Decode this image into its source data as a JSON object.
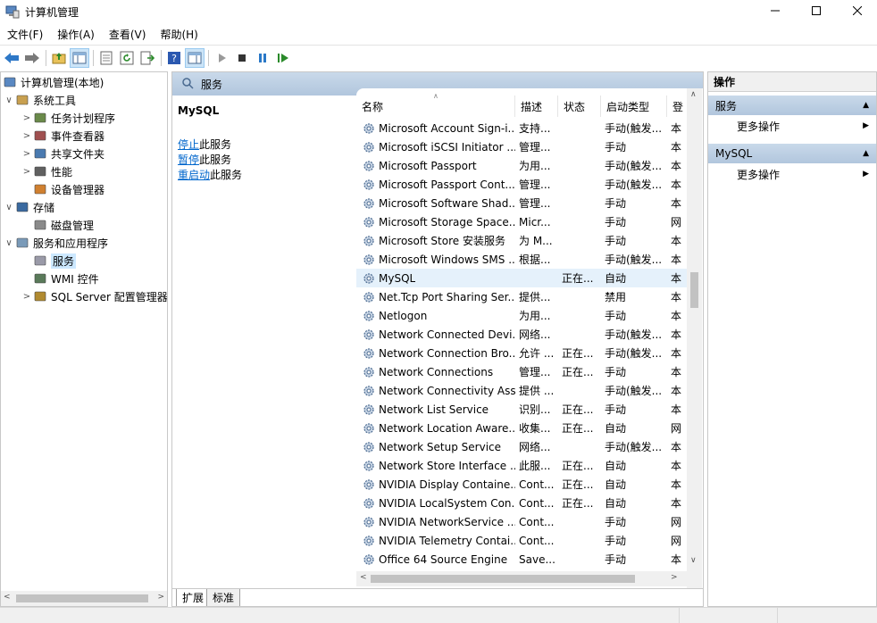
{
  "window": {
    "title": "计算机管理"
  },
  "menu": [
    "文件(F)",
    "操作(A)",
    "查看(V)",
    "帮助(H)"
  ],
  "toolbar": {
    "buttons": [
      "back-icon",
      "forward-icon",
      "up-folder-icon",
      "show-hide-tree-icon",
      "properties-icon",
      "refresh-icon",
      "export-list-icon",
      "help-icon",
      "show-hide-action-icon",
      "play-icon",
      "stop-icon",
      "pause-icon",
      "resume-icon"
    ]
  },
  "tree": {
    "items": [
      {
        "label": "计算机管理(本地)",
        "level": 0,
        "expander": ""
      },
      {
        "label": "系统工具",
        "level": 1,
        "expander": "∨"
      },
      {
        "label": "任务计划程序",
        "level": 2,
        "expander": ">"
      },
      {
        "label": "事件查看器",
        "level": 2,
        "expander": ">"
      },
      {
        "label": "共享文件夹",
        "level": 2,
        "expander": ">"
      },
      {
        "label": "性能",
        "level": 2,
        "expander": ">"
      },
      {
        "label": "设备管理器",
        "level": 2,
        "expander": ""
      },
      {
        "label": "存储",
        "level": 1,
        "expander": "∨"
      },
      {
        "label": "磁盘管理",
        "level": 2,
        "expander": ""
      },
      {
        "label": "服务和应用程序",
        "level": 1,
        "expander": "∨"
      },
      {
        "label": "服务",
        "level": 2,
        "expander": "",
        "selected": true
      },
      {
        "label": "WMI 控件",
        "level": 2,
        "expander": ""
      },
      {
        "label": "SQL Server 配置管理器",
        "level": 2,
        "expander": ">"
      }
    ]
  },
  "center": {
    "header": "服务",
    "extended": {
      "title": "MySQL",
      "links": [
        {
          "link": "停止",
          "rest": "此服务"
        },
        {
          "link": "暂停",
          "rest": "此服务"
        },
        {
          "link": "重启动",
          "rest": "此服务"
        }
      ]
    },
    "columns": [
      "名称",
      "描述",
      "状态",
      "启动类型",
      "登"
    ],
    "rows": [
      {
        "name": "Microsoft Account Sign-i...",
        "desc": "支持...",
        "status": "",
        "start": "手动(触发...",
        "logon": "本"
      },
      {
        "name": "Microsoft iSCSI Initiator ...",
        "desc": "管理...",
        "status": "",
        "start": "手动",
        "logon": "本"
      },
      {
        "name": "Microsoft Passport",
        "desc": "为用...",
        "status": "",
        "start": "手动(触发...",
        "logon": "本"
      },
      {
        "name": "Microsoft Passport Cont...",
        "desc": "管理...",
        "status": "",
        "start": "手动(触发...",
        "logon": "本"
      },
      {
        "name": "Microsoft Software Shad...",
        "desc": "管理...",
        "status": "",
        "start": "手动",
        "logon": "本"
      },
      {
        "name": "Microsoft Storage Space...",
        "desc": "Micr...",
        "status": "",
        "start": "手动",
        "logon": "网"
      },
      {
        "name": "Microsoft Store 安装服务",
        "desc": "为 M...",
        "status": "",
        "start": "手动",
        "logon": "本"
      },
      {
        "name": "Microsoft Windows SMS ...",
        "desc": "根据...",
        "status": "",
        "start": "手动(触发...",
        "logon": "本"
      },
      {
        "name": "MySQL",
        "desc": "",
        "status": "正在...",
        "start": "自动",
        "logon": "本",
        "selected": true
      },
      {
        "name": "Net.Tcp Port Sharing Ser...",
        "desc": "提供...",
        "status": "",
        "start": "禁用",
        "logon": "本"
      },
      {
        "name": "Netlogon",
        "desc": "为用...",
        "status": "",
        "start": "手动",
        "logon": "本"
      },
      {
        "name": "Network Connected Devi...",
        "desc": "网络...",
        "status": "",
        "start": "手动(触发...",
        "logon": "本"
      },
      {
        "name": "Network Connection Bro...",
        "desc": "允许 ...",
        "status": "正在...",
        "start": "手动(触发...",
        "logon": "本"
      },
      {
        "name": "Network Connections",
        "desc": "管理...",
        "status": "正在...",
        "start": "手动",
        "logon": "本"
      },
      {
        "name": "Network Connectivity Ass...",
        "desc": "提供 ...",
        "status": "",
        "start": "手动(触发...",
        "logon": "本"
      },
      {
        "name": "Network List Service",
        "desc": "识别...",
        "status": "正在...",
        "start": "手动",
        "logon": "本"
      },
      {
        "name": "Network Location Aware...",
        "desc": "收集...",
        "status": "正在...",
        "start": "自动",
        "logon": "网"
      },
      {
        "name": "Network Setup Service",
        "desc": "网络...",
        "status": "",
        "start": "手动(触发...",
        "logon": "本"
      },
      {
        "name": "Network Store Interface ...",
        "desc": "此服...",
        "status": "正在...",
        "start": "自动",
        "logon": "本"
      },
      {
        "name": "NVIDIA Display Containe...",
        "desc": "Cont...",
        "status": "正在...",
        "start": "自动",
        "logon": "本"
      },
      {
        "name": "NVIDIA LocalSystem Con...",
        "desc": "Cont...",
        "status": "正在...",
        "start": "自动",
        "logon": "本"
      },
      {
        "name": "NVIDIA NetworkService ...",
        "desc": "Cont...",
        "status": "",
        "start": "手动",
        "logon": "网"
      },
      {
        "name": "NVIDIA Telemetry Contai...",
        "desc": "Cont...",
        "status": "",
        "start": "手动",
        "logon": "网"
      },
      {
        "name": "Office 64 Source Engine",
        "desc": "Save...",
        "status": "",
        "start": "手动",
        "logon": "本"
      }
    ],
    "tabs": [
      "扩展",
      "标准"
    ]
  },
  "actions": {
    "title": "操作",
    "sections": [
      {
        "header": "服务",
        "item": "更多操作"
      },
      {
        "header": "MySQL",
        "item": "更多操作"
      }
    ]
  },
  "colors": {
    "accent_header": "#b1c6dd",
    "selection": "#cce8ff",
    "link": "#0066cc"
  }
}
